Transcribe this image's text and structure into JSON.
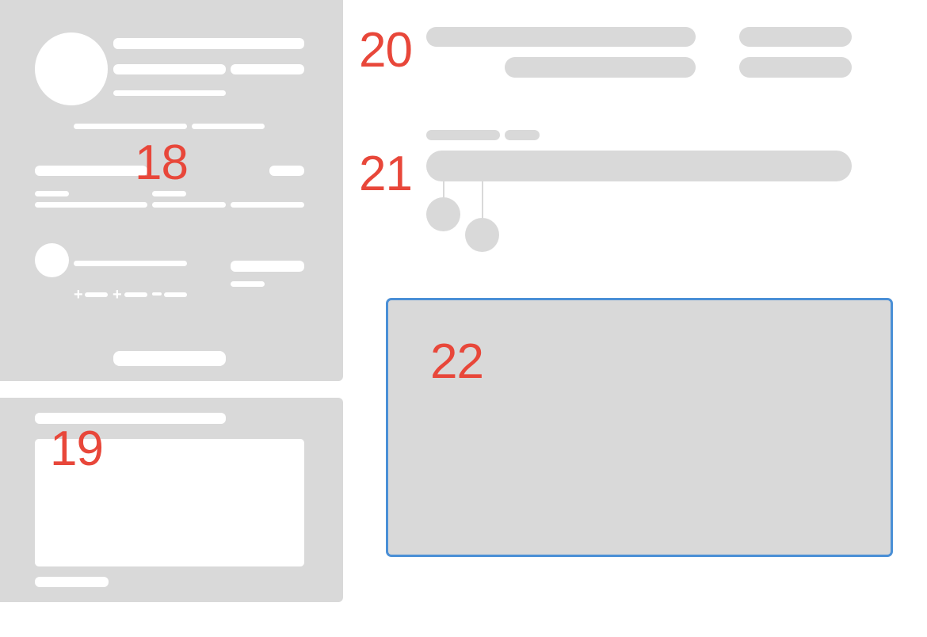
{
  "labels": {
    "n18": "18",
    "n19": "19",
    "n20": "20",
    "n21": "21",
    "n22": "22"
  },
  "colors": {
    "placeholder": "#d9d9d9",
    "label": "#e8473a",
    "selection": "#4a8fd6",
    "background": "#ffffff"
  },
  "selected_block": "22"
}
